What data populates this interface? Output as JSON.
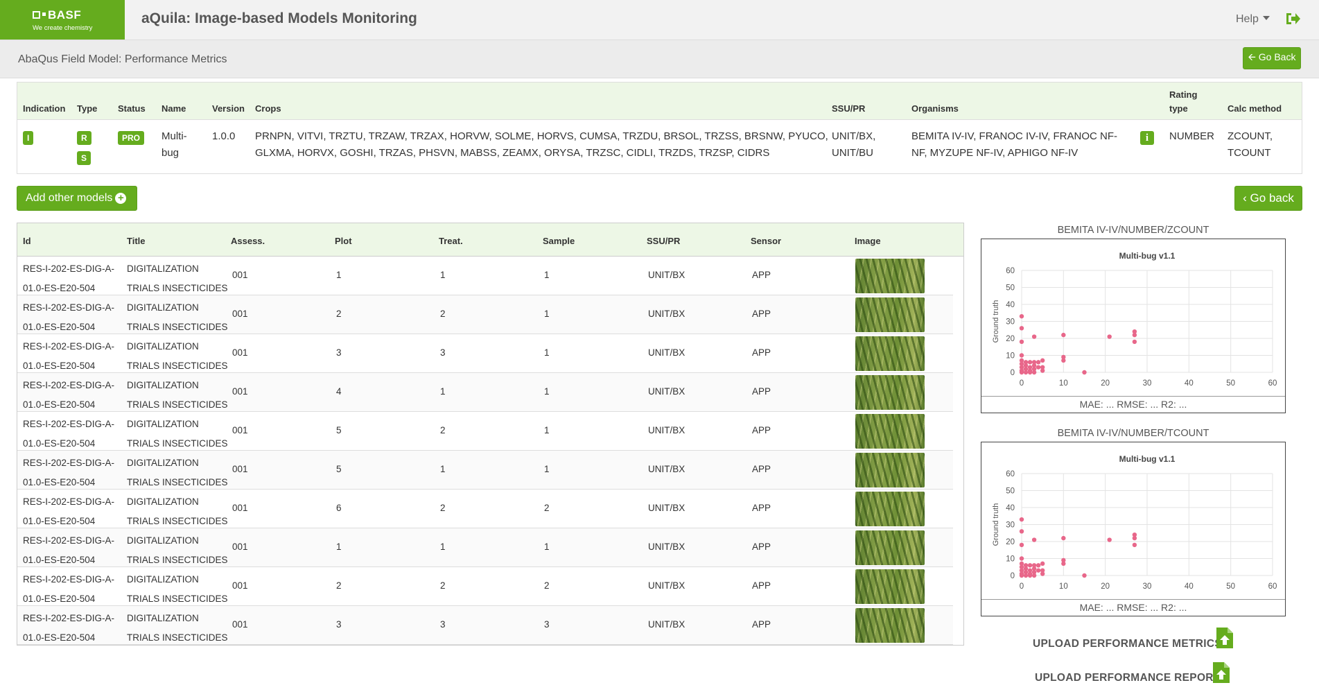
{
  "header": {
    "logo_brand": "BASF",
    "logo_tagline": "We create chemistry",
    "app_title": "aQuila: Image-based Models Monitoring",
    "help_label": "Help",
    "logout_icon": "logout-icon"
  },
  "subheader": {
    "page_title": "AbaQus Field Model: Performance Metrics",
    "go_back_label": "Go Back"
  },
  "model": {
    "headers": {
      "indication": "Indication",
      "type": "Type",
      "status": "Status",
      "name": "Name",
      "version": "Version",
      "crops": "Crops",
      "ssu": "SSU/PR",
      "organisms": "Organisms",
      "rating_type_1": "Rating",
      "rating_type_2": "type",
      "calc_method": "Calc method"
    },
    "indication": "I",
    "type_badges": [
      "R",
      "S"
    ],
    "status": "PRO",
    "name_line1": "Multi-",
    "name_line2": "bug",
    "version": "1.0.0",
    "crops_line1": "PRNPN, VITVI, TRZTU, TRZAW, TRZAX, HORVW, SOLME, HORVS, CUMSA, TRZDU, BRSOL, TRZSS, BRSNW, PYUCO,",
    "crops_line2": "GLXMA, HORVX, GOSHI, TRZAS, PHSVN, MABSS, ZEAMX, ORYSA, TRZSC, CIDLI, TRZDS, TRZSP, CIDRS",
    "ssu_line1": "UNIT/BX,",
    "ssu_line2": "UNIT/BU",
    "organisms_line1": "BEMITA IV-IV, FRANOC IV-IV, FRANOC NF-",
    "organisms_line2": "NF, MYZUPE NF-IV, APHIGO NF-IV",
    "info_icon": "i",
    "rating_type": "NUMBER",
    "calc_line1": "ZCOUNT,",
    "calc_line2": "TCOUNT"
  },
  "actions": {
    "add_models_label": "Add other models",
    "go_back_label": "Go back"
  },
  "table": {
    "headers": [
      "Id",
      "Title",
      "Assess.",
      "Plot",
      "Treat.",
      "Sample",
      "SSU/PR",
      "Sensor",
      "Image"
    ],
    "rows": [
      {
        "id1": "RES-I-202-ES-DIG-A-",
        "id2": "01.0-ES-E20-504",
        "t1": "DIGITALIZATION",
        "t2": "TRIALS INSECTICIDES",
        "assess": "001",
        "plot": "1",
        "treat": "1",
        "sample": "1",
        "ssu": "UNIT/BX",
        "sensor": "APP"
      },
      {
        "id1": "RES-I-202-ES-DIG-A-",
        "id2": "01.0-ES-E20-504",
        "t1": "DIGITALIZATION",
        "t2": "TRIALS INSECTICIDES",
        "assess": "001",
        "plot": "2",
        "treat": "2",
        "sample": "1",
        "ssu": "UNIT/BX",
        "sensor": "APP"
      },
      {
        "id1": "RES-I-202-ES-DIG-A-",
        "id2": "01.0-ES-E20-504",
        "t1": "DIGITALIZATION",
        "t2": "TRIALS INSECTICIDES",
        "assess": "001",
        "plot": "3",
        "treat": "3",
        "sample": "1",
        "ssu": "UNIT/BX",
        "sensor": "APP"
      },
      {
        "id1": "RES-I-202-ES-DIG-A-",
        "id2": "01.0-ES-E20-504",
        "t1": "DIGITALIZATION",
        "t2": "TRIALS INSECTICIDES",
        "assess": "001",
        "plot": "4",
        "treat": "1",
        "sample": "1",
        "ssu": "UNIT/BX",
        "sensor": "APP"
      },
      {
        "id1": "RES-I-202-ES-DIG-A-",
        "id2": "01.0-ES-E20-504",
        "t1": "DIGITALIZATION",
        "t2": "TRIALS INSECTICIDES",
        "assess": "001",
        "plot": "5",
        "treat": "2",
        "sample": "1",
        "ssu": "UNIT/BX",
        "sensor": "APP"
      },
      {
        "id1": "RES-I-202-ES-DIG-A-",
        "id2": "01.0-ES-E20-504",
        "t1": "DIGITALIZATION",
        "t2": "TRIALS INSECTICIDES",
        "assess": "001",
        "plot": "5",
        "treat": "1",
        "sample": "1",
        "ssu": "UNIT/BX",
        "sensor": "APP"
      },
      {
        "id1": "RES-I-202-ES-DIG-A-",
        "id2": "01.0-ES-E20-504",
        "t1": "DIGITALIZATION",
        "t2": "TRIALS INSECTICIDES",
        "assess": "001",
        "plot": "6",
        "treat": "2",
        "sample": "2",
        "ssu": "UNIT/BX",
        "sensor": "APP"
      },
      {
        "id1": "RES-I-202-ES-DIG-A-",
        "id2": "01.0-ES-E20-504",
        "t1": "DIGITALIZATION",
        "t2": "TRIALS INSECTICIDES",
        "assess": "001",
        "plot": "1",
        "treat": "1",
        "sample": "1",
        "ssu": "UNIT/BX",
        "sensor": "APP"
      },
      {
        "id1": "RES-I-202-ES-DIG-A-",
        "id2": "01.0-ES-E20-504",
        "t1": "DIGITALIZATION",
        "t2": "TRIALS INSECTICIDES",
        "assess": "001",
        "plot": "2",
        "treat": "2",
        "sample": "2",
        "ssu": "UNIT/BX",
        "sensor": "APP"
      },
      {
        "id1": "RES-I-202-ES-DIG-A-",
        "id2": "01.0-ES-E20-504",
        "t1": "DIGITALIZATION",
        "t2": "TRIALS INSECTICIDES",
        "assess": "001",
        "plot": "3",
        "treat": "3",
        "sample": "3",
        "ssu": "UNIT/BX",
        "sensor": "APP"
      }
    ]
  },
  "charts": [
    {
      "heading": "BEMITA IV-IV/NUMBER/ZCOUNT",
      "metrics": "MAE: ...  RMSE: ...  R2: ..."
    },
    {
      "heading": "BEMITA IV-IV/NUMBER/TCOUNT",
      "metrics": "MAE: ...  RMSE: ...  R2: ..."
    }
  ],
  "chart_data": [
    {
      "type": "scatter",
      "title": "Multi-bug v1.1",
      "xlabel": "",
      "ylabel": "Ground truth",
      "xlim": [
        0,
        60
      ],
      "ylim": [
        0,
        60
      ],
      "x_ticks": [
        0,
        10,
        20,
        30,
        40,
        50,
        60
      ],
      "y_ticks": [
        0,
        10,
        20,
        30,
        40,
        50,
        60
      ],
      "grid": true,
      "color": "#e8678a",
      "points": [
        [
          0,
          33
        ],
        [
          0,
          26
        ],
        [
          0,
          18
        ],
        [
          0,
          10
        ],
        [
          0,
          7
        ],
        [
          0,
          5
        ],
        [
          0,
          3
        ],
        [
          0,
          1
        ],
        [
          0,
          0
        ],
        [
          1,
          6
        ],
        [
          1,
          4
        ],
        [
          1,
          2
        ],
        [
          1,
          0
        ],
        [
          2,
          6
        ],
        [
          2,
          3
        ],
        [
          2,
          1
        ],
        [
          2,
          0
        ],
        [
          3,
          6
        ],
        [
          3,
          4
        ],
        [
          3,
          2
        ],
        [
          3,
          0
        ],
        [
          4,
          6
        ],
        [
          4,
          3
        ],
        [
          3,
          21
        ],
        [
          5,
          7
        ],
        [
          5,
          3
        ],
        [
          5,
          1
        ],
        [
          10,
          22
        ],
        [
          10,
          9
        ],
        [
          10,
          7
        ],
        [
          15,
          0
        ],
        [
          21,
          21
        ],
        [
          27,
          24
        ],
        [
          27,
          22
        ],
        [
          27,
          18
        ]
      ]
    },
    {
      "type": "scatter",
      "title": "Multi-bug v1.1",
      "xlabel": "",
      "ylabel": "Ground truth",
      "xlim": [
        0,
        60
      ],
      "ylim": [
        0,
        60
      ],
      "x_ticks": [
        0,
        10,
        20,
        30,
        40,
        50,
        60
      ],
      "y_ticks": [
        0,
        10,
        20,
        30,
        40,
        50,
        60
      ],
      "grid": true,
      "color": "#e8678a",
      "points": [
        [
          0,
          33
        ],
        [
          0,
          26
        ],
        [
          0,
          18
        ],
        [
          0,
          10
        ],
        [
          0,
          7
        ],
        [
          0,
          5
        ],
        [
          0,
          3
        ],
        [
          0,
          1
        ],
        [
          0,
          0
        ],
        [
          1,
          6
        ],
        [
          1,
          4
        ],
        [
          1,
          2
        ],
        [
          1,
          0
        ],
        [
          2,
          6
        ],
        [
          2,
          3
        ],
        [
          2,
          1
        ],
        [
          2,
          0
        ],
        [
          3,
          6
        ],
        [
          3,
          4
        ],
        [
          3,
          2
        ],
        [
          3,
          0
        ],
        [
          4,
          6
        ],
        [
          4,
          3
        ],
        [
          3,
          21
        ],
        [
          5,
          7
        ],
        [
          5,
          3
        ],
        [
          5,
          1
        ],
        [
          10,
          22
        ],
        [
          10,
          9
        ],
        [
          10,
          7
        ],
        [
          15,
          0
        ],
        [
          21,
          21
        ],
        [
          27,
          24
        ],
        [
          27,
          22
        ],
        [
          27,
          18
        ]
      ]
    }
  ],
  "uploads": {
    "metrics_label": "UPLOAD PERFORMANCE METRICS",
    "report_label": "UPLOAD PERFORMANCE REPORT"
  },
  "colors": {
    "brand_green": "#65ac1e",
    "header_green_tint": "#edf7e6",
    "point_pink": "#e8678a"
  }
}
